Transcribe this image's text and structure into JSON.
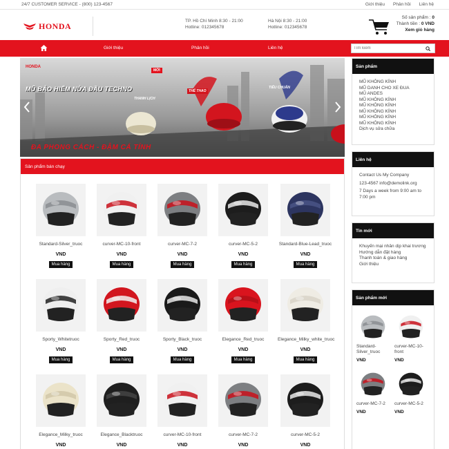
{
  "topbar": {
    "customer_service": "24/7 CUSTOMER SERVICE - (800) 123-4567",
    "links": [
      "Giới thiệu",
      "Phản hồi",
      "Liên hệ"
    ]
  },
  "header": {
    "logo_text": "HONDA",
    "hcm_line1": "TP. Hồ Chí Minh 8:30 - 21:00",
    "hcm_line2": "Hotline: 012345678",
    "hn_line1": "Hà Nội 8:30 - 21:00",
    "hn_line2": "Hotline: 012345678",
    "cart_count_label": "Số sản phẩm :",
    "cart_count_value": "0",
    "cart_total_label": "Thành tiền :",
    "cart_total_value": "0 VND",
    "cart_view": "Xem giỏ hàng"
  },
  "nav": {
    "items": [
      "Giới thiệu",
      "Phản hồi",
      "Liên hệ"
    ],
    "search_placeholder": "Tìm kiếm"
  },
  "banner": {
    "brand": "HONDA",
    "headline": "MŨ BẢO HIỂM NỬA ĐẦU TECHNO",
    "new_badge": "MỚI",
    "label1": "THANH LỊCH",
    "label2": "THỂ THAO",
    "label3": "TIÊU CHUẨN",
    "tagline": "ĐA PHONG CÁCH - ĐẬM CÁ TÍNH"
  },
  "products": {
    "section_title": "Sản phẩm bán chạy",
    "price_label": "VND",
    "buy_label": "Mua hàng",
    "items": [
      {
        "name": "Standard-Silver_truoc",
        "color": "#b9bcbf",
        "accent": "#8a8d90"
      },
      {
        "name": "curver-MC-10-front",
        "color": "#f0f0f0",
        "accent": "#c8101b"
      },
      {
        "name": "curver-MC-7-2",
        "color": "#7d7f82",
        "accent": "#c8101b"
      },
      {
        "name": "curver-MC-5-2",
        "color": "#1d1d1d",
        "accent": "#e8e8e8"
      },
      {
        "name": "Standard-Blue-Lead_truoc",
        "color": "#2d3560",
        "accent": "#4a5386"
      },
      {
        "name": "Sporty_Whitetruoc",
        "color": "#efefef",
        "accent": "#222222"
      },
      {
        "name": "Sporty_Red_truoc",
        "color": "#d2161f",
        "accent": "#f2f2f2"
      },
      {
        "name": "Sporty_Black_truoc",
        "color": "#1a1a1a",
        "accent": "#e6e6e6"
      },
      {
        "name": "Elegance_Red_truoc",
        "color": "#d9141e",
        "accent": "#b20f17"
      },
      {
        "name": "Elegance_Milky_white_truoc",
        "color": "#efece4",
        "accent": "#d8d4c8"
      },
      {
        "name": "Elegance_Milky_truoc",
        "color": "#ebe3c9",
        "accent": "#d1c7a8"
      },
      {
        "name": "Elegance_Blacktruoc",
        "color": "#1f1f1f",
        "accent": "#444444"
      },
      {
        "name": "curver-MC-10-front",
        "color": "#f0f0f0",
        "accent": "#c8101b"
      },
      {
        "name": "curver-MC-7-2",
        "color": "#7d7f82",
        "accent": "#c8101b"
      },
      {
        "name": "curver-MC-5-2",
        "color": "#1d1d1d",
        "accent": "#e8e8e8"
      }
    ]
  },
  "sidebar": {
    "products_title": "Sản phẩm",
    "product_links": [
      "MŨ KHÔNG KÍNH",
      "MŨ DANH CHO XE ĐUA",
      "MŨ ANDES",
      "MŨ KHÔNG KÍNH",
      "MŨ KHÔNG KÍNH",
      "MŨ KHÔNG KÍNH",
      "MŨ KHÔNG KÍNH",
      "MŨ KHÔNG KÍNH",
      "Dịch vụ sửa chữa"
    ],
    "contact_title": "Liên hệ",
    "contact_lines": [
      "Contact Us My Company",
      "123-4567 info@demolink.org",
      "7 Days a week from 9:00 am to 7:00 pm"
    ],
    "news_title": "Tin mới",
    "news_links": [
      "Khuyến mại nhân dịp khai trương",
      "Hướng dẫn đặt hàng",
      "Thanh toán & giao hàng",
      "Giới thiệu"
    ],
    "new_title": "Sản phẩm mới",
    "new_items": [
      {
        "name": "Standard-Silver_truoc",
        "price": "VND",
        "color": "#b9bcbf",
        "accent": "#8a8d90"
      },
      {
        "name": "curver-MC-10-front",
        "price": "VND",
        "color": "#f0f0f0",
        "accent": "#c8101b"
      },
      {
        "name": "curver-MC-7-2",
        "price": "VND",
        "color": "#7d7f82",
        "accent": "#c8101b"
      },
      {
        "name": "curver-MC-5-2",
        "price": "VND",
        "color": "#1d1d1d",
        "accent": "#e8e8e8"
      }
    ]
  },
  "colors": {
    "brand_red": "#e3131e",
    "dark": "#111111"
  }
}
